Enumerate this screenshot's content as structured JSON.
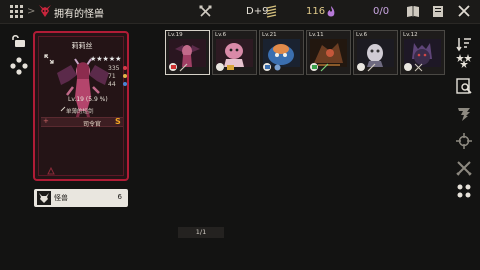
{
  "header": {
    "title": "拥有的怪兽",
    "day_label": "D+9",
    "gold": "116",
    "soul_count": "0/0"
  },
  "card": {
    "name": "莉莉丝",
    "stars": "★★★★★",
    "stat_1": "335",
    "stat_2": "71",
    "stat_3": "44",
    "level_line": "Lv.19 (5.9 %)",
    "weapon": "单薄的短剑",
    "rank_label": "司令官",
    "rank_grade": "S"
  },
  "monster_tab": {
    "label": "怪兽",
    "count": "6"
  },
  "slots": [
    {
      "level": "Lv.19",
      "color": "#6a2f44"
    },
    {
      "level": "Lv.6",
      "color": "#8a3f5a"
    },
    {
      "level": "Lv.21",
      "color": "#2e4f78"
    },
    {
      "level": "Lv.11",
      "color": "#5a3a2a"
    },
    {
      "level": "Lv.6",
      "color": "#3b3a48"
    },
    {
      "level": "Lv.12",
      "color": "#3e2f4a"
    }
  ],
  "pager": {
    "text": "1/1"
  },
  "colors": {
    "accent_red": "#b01c36",
    "grade_orange": "#f5a623",
    "gold": "#dfc98a"
  }
}
